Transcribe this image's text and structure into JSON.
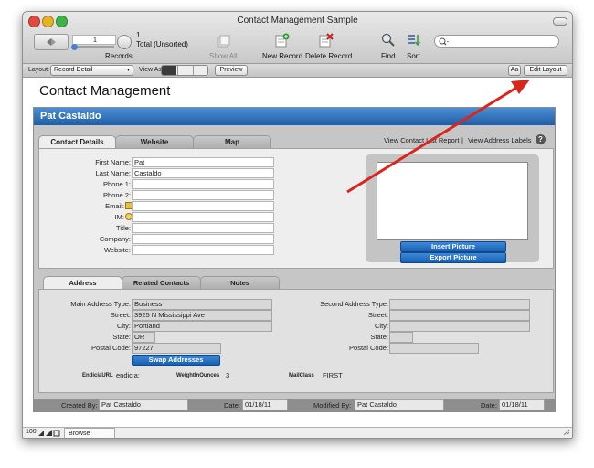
{
  "window": {
    "title": "Contact Management Sample"
  },
  "toolbar": {
    "record_number": "1",
    "total_count": "1",
    "total_label": "Total (Unsorted)",
    "records_label": "Records",
    "show_all": "Show All",
    "new_record": "New Record",
    "delete_record": "Delete Record",
    "find": "Find",
    "sort": "Sort",
    "search_placeholder": ""
  },
  "layout_bar": {
    "layout_label": "Layout:",
    "layout_value": "Record Detail",
    "view_as_label": "View As:",
    "preview": "Preview",
    "aa": "Aa",
    "edit_layout": "Edit Layout"
  },
  "app": {
    "heading": "Contact Management"
  },
  "contact": {
    "name": "Pat Castaldo"
  },
  "top_tabs": [
    "Contact Details",
    "Website",
    "Map"
  ],
  "links": {
    "view_list": "View Contact List Report",
    "separator": "|",
    "view_labels": "View Address Labels",
    "help": "?"
  },
  "fields": {
    "first_name_label": "First Name:",
    "first_name": "Pat",
    "last_name_label": "Last Name:",
    "last_name": "Castaldo",
    "phone1_label": "Phone 1:",
    "phone2_label": "Phone 2:",
    "email_label": "Email:",
    "im_label": "IM:",
    "title_label": "Title:",
    "company_label": "Company:",
    "website_label": "Website:"
  },
  "picture": {
    "insert": "Insert Picture",
    "export": "Export Picture"
  },
  "address_tabs": [
    "Address",
    "Related Contacts",
    "Notes"
  ],
  "address": {
    "main_type_label": "Main Address Type:",
    "main_type": "Business",
    "street_label": "Street:",
    "street": "3925 N Mississippi Ave",
    "city_label": "City:",
    "city": "Portland",
    "state_label": "State:",
    "state": "OR",
    "postal_label": "Postal Code:",
    "postal": "97227",
    "second_type_label": "Second Address Type:",
    "street2_label": "Street:",
    "city2_label": "City:",
    "state2_label": "State:",
    "postal2_label": "Postal Code:",
    "swap": "Swap Addresses",
    "endicia_url_label": "EndiciaURL",
    "endicia_url": "endicia:",
    "weight_label": "WeightInOunces",
    "weight": "3",
    "mailclass_label": "MailClass",
    "mailclass": "FIRST"
  },
  "footer": {
    "created_by_label": "Created By:",
    "created_by": "Pat Castaldo",
    "date1_label": "Date:",
    "date1": "01/18/11",
    "modified_by_label": "Modified By:",
    "modified_by": "Pat Castaldo",
    "date2_label": "Date:",
    "date2": "01/18/11"
  },
  "status": {
    "zoom": "100",
    "mode": "Browse"
  },
  "colors": {
    "header_blue": "#2b6fb5",
    "arrow_red": "#d9261c",
    "button_blue": "#1f6bbd"
  }
}
